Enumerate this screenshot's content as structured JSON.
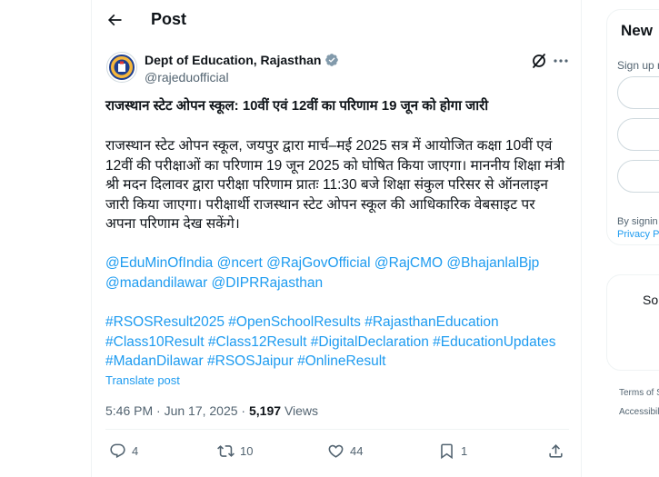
{
  "header": {
    "title": "Post",
    "back_icon": "arrow-left-icon"
  },
  "tweet": {
    "author": {
      "name": "Dept of Education, Rajasthan",
      "handle": "@rajeduofficial",
      "verified": true,
      "avatar_icon": "state-emblem-icon",
      "verified_color": "#829aab"
    },
    "heading": "राजस्थान स्टेट ओपन स्कूल: 10वीं एवं 12वीं का परिणाम 19 जून को होगा जारी",
    "body": "राजस्थान स्टेट ओपन स्कूल, जयपुर द्वारा मार्च–मई 2025 सत्र में आयोजित कक्षा 10वीं एवं 12वीं की परीक्षाओं का परिणाम 19 जून 2025 को घोषित किया जाएगा। माननीय शिक्षा मंत्री श्री मदन दिलावर द्वारा परीक्षा परिणाम प्रातः 11:30 बजे शिक्षा संकुल परिसर से ऑनलाइन जारी किया जाएगा। परीक्षार्थी राजस्थान स्टेट ओपन स्कूल की आधिकारिक वेबसाइट पर अपना परिणाम देख सकेंगे।",
    "mentions": [
      "@EduMinOfIndia",
      "@ncert",
      "@RajGovOfficial",
      "@RajCMO",
      "@BhajanlalBjp",
      "@madandilawar",
      "@DIPRRajasthan"
    ],
    "hashtags": [
      "#RSOSResult2025",
      "#OpenSchoolResults",
      "#RajasthanEducation",
      "#Class10Result",
      "#Class12Result",
      "#DigitalDeclaration",
      "#EducationUpdates",
      "#MadanDilawar",
      "#RSOSJaipur",
      "#OnlineResult"
    ],
    "translate_label": "Translate post",
    "timestamp": "5:46 PM · Jun 17, 2025",
    "separator": " · ",
    "views_count": "5,197",
    "views_label": "Views",
    "actions": {
      "replies": "4",
      "reposts": "10",
      "likes": "44",
      "bookmarks": "1"
    },
    "link_color": "#1d9bf0"
  },
  "sidebar": {
    "signup_title": "New",
    "signup_text": "Sign up n",
    "by_signing": "By signin",
    "privacy": "Privacy P",
    "sub_text": "So",
    "footer_terms": "Terms of S",
    "footer_access": "Accessibil"
  }
}
